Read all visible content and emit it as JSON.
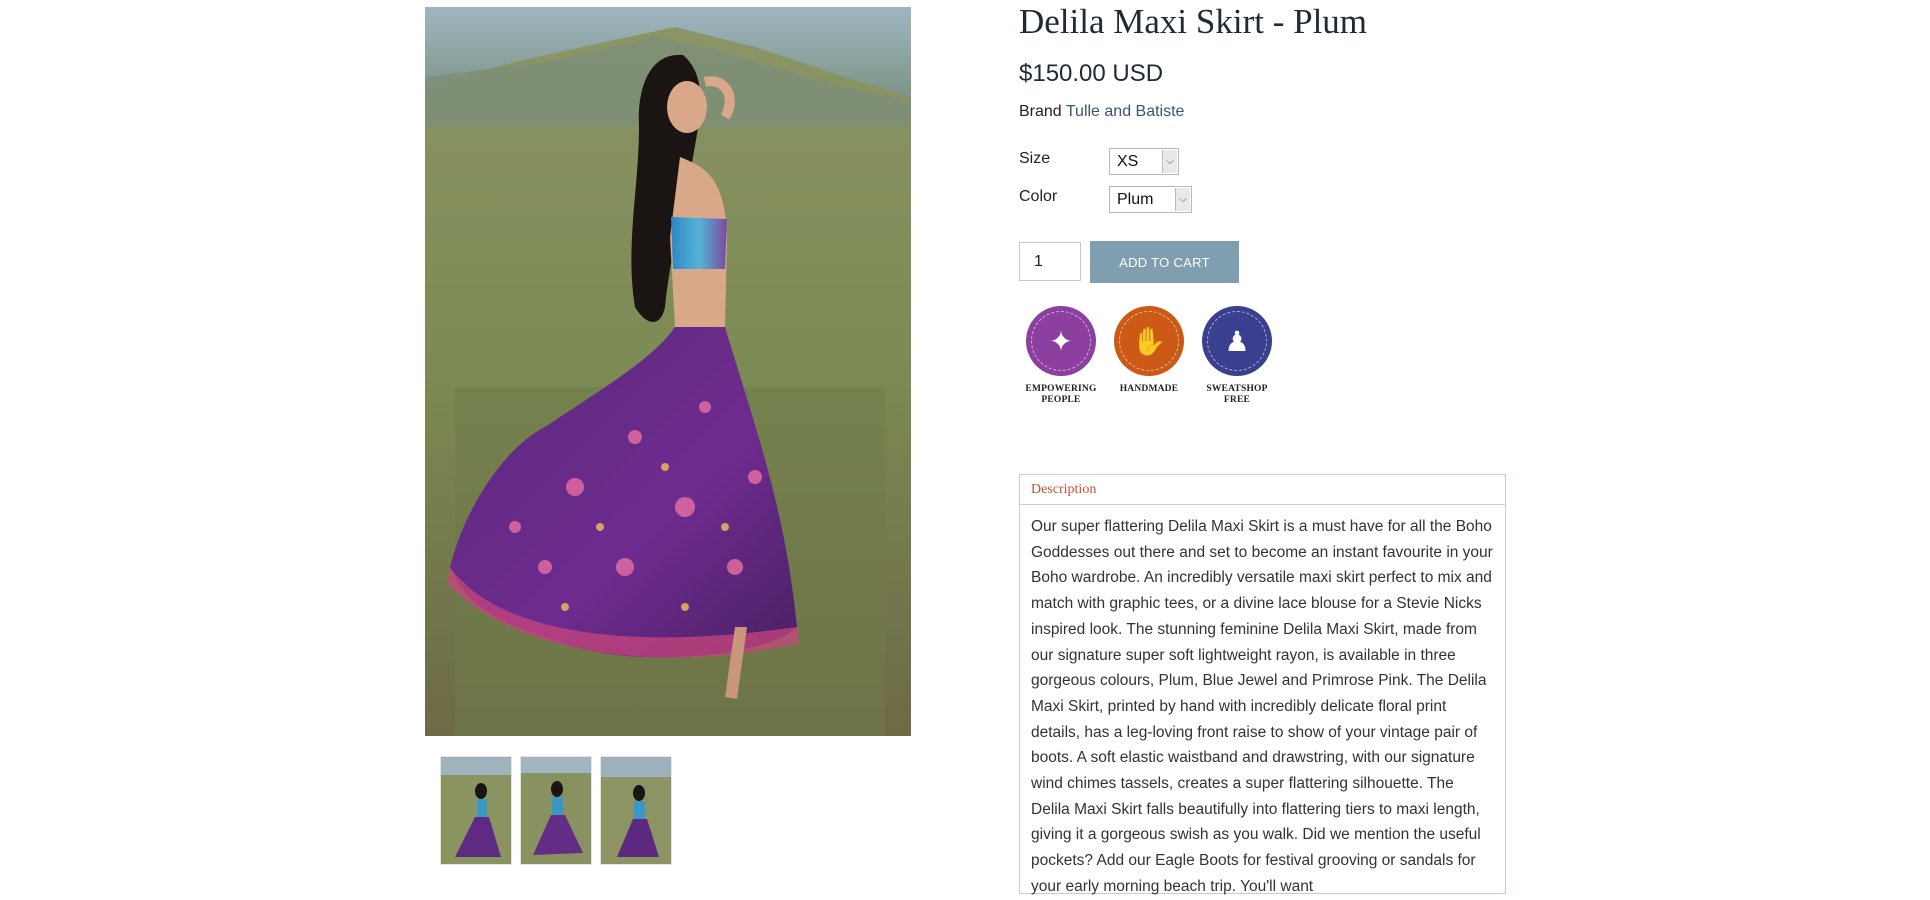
{
  "product": {
    "title": "Delila Maxi Skirt - Plum",
    "price": "$150.00 USD",
    "brand_label": "Brand",
    "brand_name": "Tulle and Batiste"
  },
  "options": {
    "size_label": "Size",
    "size_value": "XS",
    "color_label": "Color",
    "color_value": "Plum"
  },
  "cart": {
    "quantity": "1",
    "add_label": "ADD TO CART"
  },
  "badges": [
    {
      "label": "EMPOWERING PEOPLE",
      "color": "#8d3f9f",
      "icon": "kick-figure-icon"
    },
    {
      "label": "HANDMADE",
      "color": "#cc5a16",
      "icon": "hand-icon"
    },
    {
      "label": "SWEATSHOP FREE",
      "color": "#3a3f8f",
      "icon": "running-figures-icon"
    }
  ],
  "description": {
    "header": "Description",
    "text": "Our super flattering Delila Maxi Skirt is a must have for all the Boho Goddesses out there and set to become an instant favourite in your Boho wardrobe. An incredibly versatile maxi skirt perfect to mix and match with graphic tees, or a divine lace blouse for a Stevie Nicks inspired look. The stunning feminine Delila Maxi Skirt, made from our signature super soft lightweight rayon, is available in three gorgeous colours, Plum, Blue Jewel and Primrose Pink. The Delila Maxi Skirt, printed by hand with incredibly delicate floral print details, has a leg-loving front raise to show of your vintage pair of boots. A soft elastic waistband and drawstring, with our signature wind chimes tassels, creates a super flattering silhouette. The Delila Maxi Skirt falls beautifully into flattering tiers to maxi length, giving it a gorgeous swish as you walk. Did we mention the useful pockets? Add our Eagle Boots for festival grooving or sandals for your early morning beach trip. You'll want"
  },
  "colors": {
    "accent_button": "#7f9eb0",
    "description_border": "#e8c4b8",
    "description_header": "#c0503a"
  }
}
